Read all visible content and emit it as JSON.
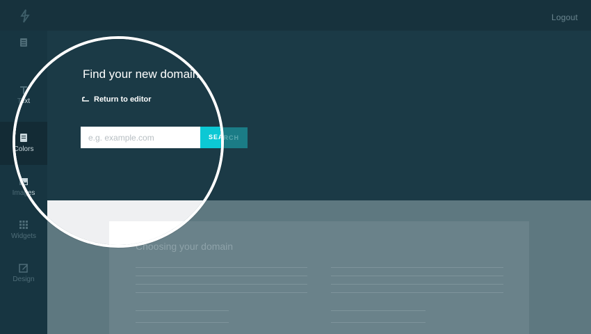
{
  "topbar": {
    "logout_label": "Logout"
  },
  "sidebar": {
    "items": [
      {
        "label": "",
        "icon": "page-icon"
      },
      {
        "label": "Text",
        "icon": "text-icon"
      },
      {
        "label": "Colors",
        "icon": "colors-icon",
        "active": true
      },
      {
        "label": "Images",
        "icon": "image-icon"
      },
      {
        "label": "Widgets",
        "icon": "grid-icon"
      },
      {
        "label": "Design",
        "icon": "edit-icon"
      }
    ]
  },
  "domain_search": {
    "title": "Find your new domain",
    "return_label": "Return to editor",
    "placeholder": "e.g. example.com",
    "search_label": "SEARCH"
  },
  "content_card": {
    "title": "Choosing your domain"
  },
  "colors": {
    "accent": "#0cc8d4",
    "header_bg": "#1b3a46",
    "sidebar_bg": "#173541",
    "page_bg": "#eff0f2"
  }
}
